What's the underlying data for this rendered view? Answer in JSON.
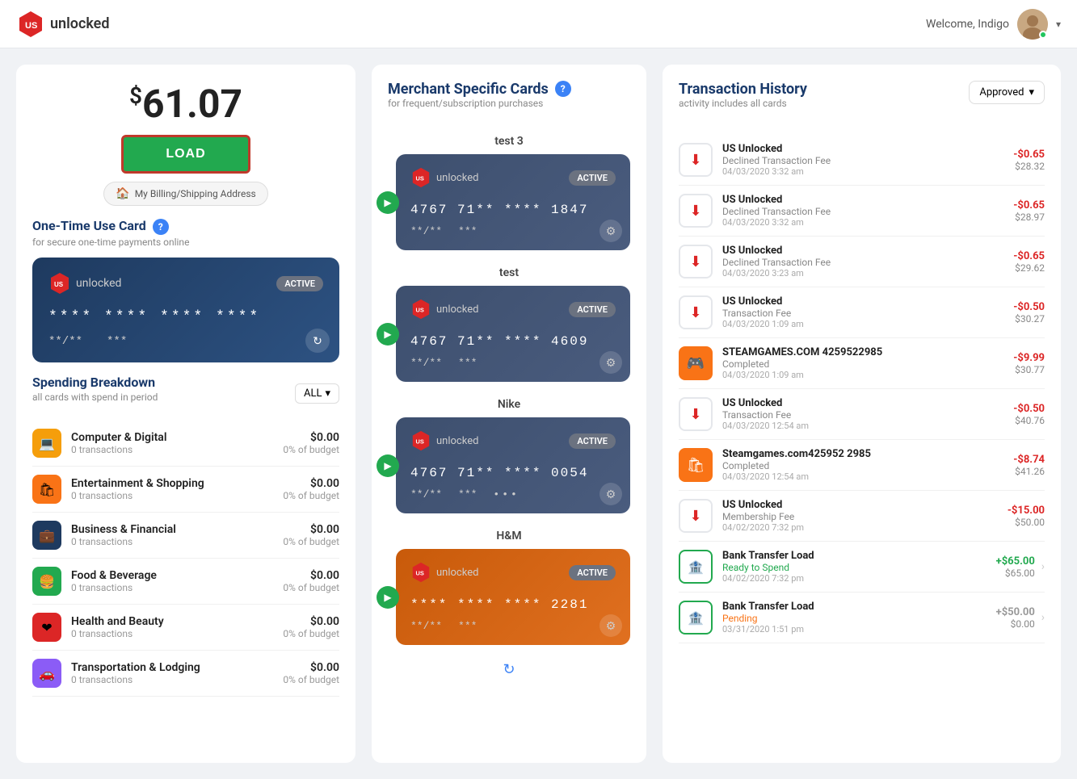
{
  "header": {
    "logo_text": "unlocked",
    "welcome": "Welcome, Indigo",
    "chevron": "▾"
  },
  "left": {
    "balance": "61.07",
    "balance_dollar": "$",
    "load_label": "LOAD",
    "billing_label": "My Billing/Shipping Address",
    "one_time_title": "One-Time Use Card",
    "one_time_sub": "for secure one-time payments online",
    "card": {
      "logo_text": "unlocked",
      "badge": "ACTIVE",
      "number": "**** **** **** ****",
      "expiry": "**/**",
      "cvv": "***"
    },
    "spending_title": "Spending Breakdown",
    "spending_sub": "all cards with spend in period",
    "spending_filter": "ALL",
    "categories": [
      {
        "name": "Computer & Digital",
        "icon": "💻",
        "color": "cat-computer",
        "transactions": "0 transactions",
        "amount": "$0.00",
        "pct": "0% of budget"
      },
      {
        "name": "Entertainment & Shopping",
        "icon": "🛍",
        "color": "cat-entertainment",
        "transactions": "0 transactions",
        "amount": "$0.00",
        "pct": "0% of budget"
      },
      {
        "name": "Business & Financial",
        "icon": "💼",
        "color": "cat-business",
        "transactions": "0 transactions",
        "amount": "$0.00",
        "pct": "0% of budget"
      },
      {
        "name": "Food & Beverage",
        "icon": "🍔",
        "color": "cat-food",
        "transactions": "0 transactions",
        "amount": "$0.00",
        "pct": "0% of budget"
      },
      {
        "name": "Health and Beauty",
        "icon": "❤",
        "color": "cat-health",
        "transactions": "0 transactions",
        "amount": "$0.00",
        "pct": "0% of budget"
      },
      {
        "name": "Transportation & Lodging",
        "icon": "🚗",
        "color": "cat-transport",
        "transactions": "0 transactions",
        "amount": "$0.00",
        "pct": "0% of budget"
      }
    ]
  },
  "middle": {
    "title": "Merchant Specific Cards",
    "subtitle": "for frequent/subscription purchases",
    "cards": [
      {
        "label": "test 3",
        "badge": "ACTIVE",
        "number": "4767  71**  ****  1847",
        "expiry": "**/**",
        "cvv": "***",
        "color": "dark"
      },
      {
        "label": "test",
        "badge": "ACTIVE",
        "number": "4767  71**  ****  4609",
        "expiry": "**/**",
        "cvv": "***",
        "color": "dark"
      },
      {
        "label": "Nike",
        "badge": "ACTIVE",
        "number": "4767  71**  ****  0054",
        "expiry": "**/**",
        "cvv": "***",
        "dots": "•••",
        "color": "dark"
      },
      {
        "label": "H&M",
        "badge": "ACTIVE",
        "number": "**** **** **** 2281",
        "expiry": "**/**",
        "cvv": "***",
        "color": "orange"
      }
    ]
  },
  "right": {
    "title": "Transaction History",
    "subtitle": "activity includes all cards",
    "filter": "Approved",
    "transactions": [
      {
        "name": "US Unlocked",
        "desc": "Declined Transaction Fee",
        "date": "04/03/2020 3:32 am",
        "amount": "-$0.65",
        "balance": "$28.32",
        "type": "declined",
        "icon": "⬇"
      },
      {
        "name": "US Unlocked",
        "desc": "Declined Transaction Fee",
        "date": "04/03/2020 3:32 am",
        "amount": "-$0.65",
        "balance": "$28.97",
        "type": "declined",
        "icon": "⬇"
      },
      {
        "name": "US Unlocked",
        "desc": "Declined Transaction Fee",
        "date": "04/03/2020 3:23 am",
        "amount": "-$0.65",
        "balance": "$29.62",
        "type": "declined",
        "icon": "⬇"
      },
      {
        "name": "US Unlocked",
        "desc": "Transaction Fee",
        "date": "04/03/2020 1:09 am",
        "amount": "-$0.50",
        "balance": "$30.27",
        "type": "declined",
        "icon": "⬇"
      },
      {
        "name": "STEAMGAMES.COM 4259522985",
        "desc": "Completed",
        "date": "04/03/2020 1:09 am",
        "amount": "-$9.99",
        "balance": "$30.77",
        "type": "steam",
        "icon": "🎮"
      },
      {
        "name": "US Unlocked",
        "desc": "Transaction Fee",
        "date": "04/03/2020 12:54 am",
        "amount": "-$0.50",
        "balance": "$40.76",
        "type": "declined",
        "icon": "⬇"
      },
      {
        "name": "Steamgames.com425952 2985",
        "desc": "Completed",
        "date": "04/03/2020 12:54 am",
        "amount": "-$8.74",
        "balance": "$41.26",
        "type": "steam2",
        "icon": "🛍"
      },
      {
        "name": "US Unlocked",
        "desc": "Membership Fee",
        "date": "04/02/2020 7:32 pm",
        "amount": "-$15.00",
        "balance": "$50.00",
        "type": "declined",
        "icon": "⬇"
      },
      {
        "name": "Bank Transfer Load",
        "desc": "Ready to Spend",
        "date": "04/02/2020 7:32 pm",
        "amount": "+$65.00",
        "balance": "$65.00",
        "type": "bank_pos",
        "icon": "🏦",
        "has_arrow": true
      },
      {
        "name": "Bank Transfer Load",
        "desc": "Pending",
        "date": "03/31/2020 1:51 pm",
        "amount": "+$50.00",
        "balance": "$0.00",
        "type": "bank_pending",
        "icon": "🏦",
        "has_arrow": true
      }
    ]
  }
}
